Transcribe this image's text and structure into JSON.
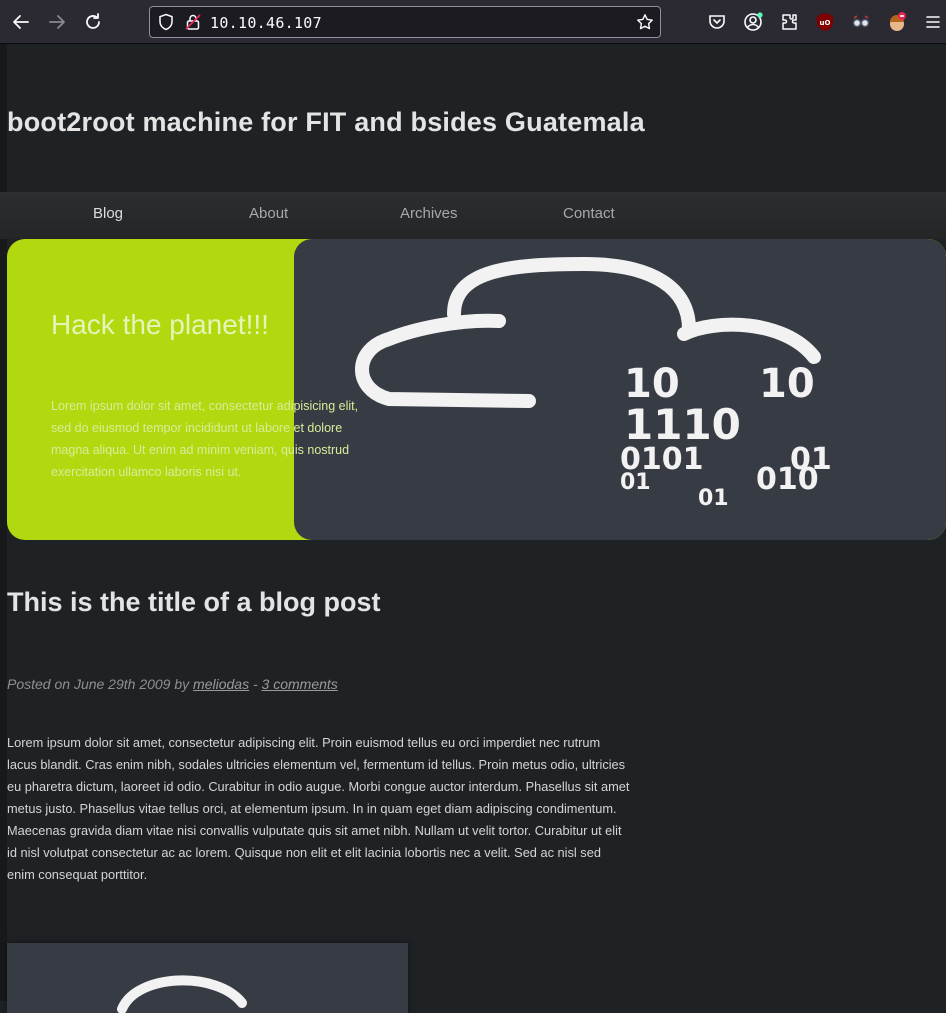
{
  "browser": {
    "url": "10.10.46.107",
    "icons": [
      "back-icon",
      "forward-icon",
      "reload-icon",
      "shield-icon",
      "lock-icon",
      "bookmark-star-icon",
      "pocket-icon",
      "account-icon",
      "extensions-icon",
      "ublock-icon",
      "extension-glasses-icon",
      "extension-avatar-icon",
      "menu-icon"
    ]
  },
  "site": {
    "title": "boot2root machine for FIT and bsides Guatemala",
    "nav": [
      "Blog",
      "About",
      "Archives",
      "Contact"
    ]
  },
  "hero": {
    "title": "Hack the planet!!!",
    "text": "Lorem ipsum dolor sit amet, consectetur adipisicing elit, sed do eiusmod tempor incididunt ut labore et dolore magna aliqua. Ut enim ad minim veniam, quis nostrud exercitation ullamco laboris nisi ut.",
    "binary_rows": [
      "10",
      "10",
      "1110",
      "0101",
      "01",
      "01",
      "010",
      "01"
    ],
    "colors": {
      "accent": "#b2d90f",
      "panel": "#373c44"
    }
  },
  "post": {
    "title": "This is the title of a blog post",
    "meta_prefix": "Posted on June 29th 2009 by ",
    "author": "meliodas",
    "separator": " - ",
    "comments": "3 comments",
    "body": "Lorem ipsum dolor sit amet, consectetur adipiscing elit. Proin euismod tellus eu orci imperdiet nec rutrum lacus blandit. Cras enim nibh, sodales ultricies elementum vel, fermentum id tellus. Proin metus odio, ultricies eu pharetra dictum, laoreet id odio. Curabitur in odio augue. Morbi congue auctor interdum. Phasellus sit amet metus justo. Phasellus vitae tellus orci, at elementum ipsum. In in quam eget diam adipiscing condimentum. Maecenas gravida diam vitae nisi convallis vulputate quis sit amet nibh. Nullam ut velit tortor. Curabitur ut elit id nisl volutpat consectetur ac ac lorem. Quisque non elit et elit lacinia lobortis nec a velit. Sed ac nisl sed enim consequat porttitor."
  }
}
